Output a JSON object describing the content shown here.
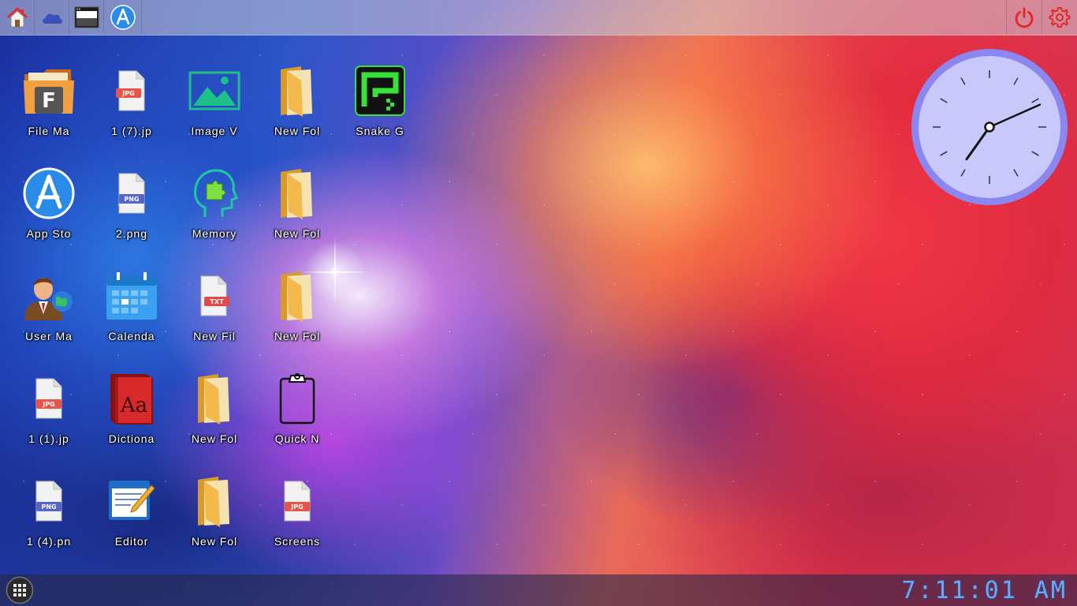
{
  "taskbar_top": {
    "left_buttons": [
      {
        "name": "home-icon"
      },
      {
        "name": "cloud-icon"
      },
      {
        "name": "screenshot-window-icon"
      },
      {
        "name": "app-store-icon"
      }
    ],
    "right_buttons": [
      {
        "name": "power-icon"
      },
      {
        "name": "settings-gear-icon"
      }
    ]
  },
  "desktop": {
    "icons": [
      {
        "label": "File Ma",
        "icon": "file-manager-icon"
      },
      {
        "label": "1 (7).jp",
        "icon": "jpg-file-icon"
      },
      {
        "label": "Image V",
        "icon": "image-viewer-icon"
      },
      {
        "label": "New Fol",
        "icon": "folder-icon"
      },
      {
        "label": "Snake G",
        "icon": "snake-game-icon"
      },
      {
        "label": "App Sto",
        "icon": "app-store-icon"
      },
      {
        "label": "2.png",
        "icon": "png-file-icon"
      },
      {
        "label": "Memory",
        "icon": "memory-game-icon"
      },
      {
        "label": "New Fol",
        "icon": "folder-icon"
      },
      {
        "label": "User Ma",
        "icon": "user-manager-icon"
      },
      {
        "label": "Calenda",
        "icon": "calendar-icon"
      },
      {
        "label": "New Fil",
        "icon": "txt-file-icon"
      },
      {
        "label": "New Fol",
        "icon": "folder-icon"
      },
      {
        "label": "1 (1).jp",
        "icon": "jpg-file-icon"
      },
      {
        "label": "Dictiona",
        "icon": "dictionary-icon"
      },
      {
        "label": "New Fol",
        "icon": "folder-icon"
      },
      {
        "label": "Quick N",
        "icon": "clipboard-icon"
      },
      {
        "label": "1 (4).pn",
        "icon": "png-file-icon"
      },
      {
        "label": "Editor",
        "icon": "editor-icon"
      },
      {
        "label": "New Fol",
        "icon": "folder-icon"
      },
      {
        "label": "Screens",
        "icon": "jpg-file-icon"
      }
    ]
  },
  "clock_widget": {
    "hour": 7,
    "minute": 11,
    "second": 1
  },
  "taskbar_bottom": {
    "start_button": "app-grid-icon",
    "time": "7:11:01 AM"
  },
  "colors": {
    "accent_red": "#e02a2a",
    "clock_face": "#c8c8fa",
    "digital_clock": "#6aaaf5"
  }
}
